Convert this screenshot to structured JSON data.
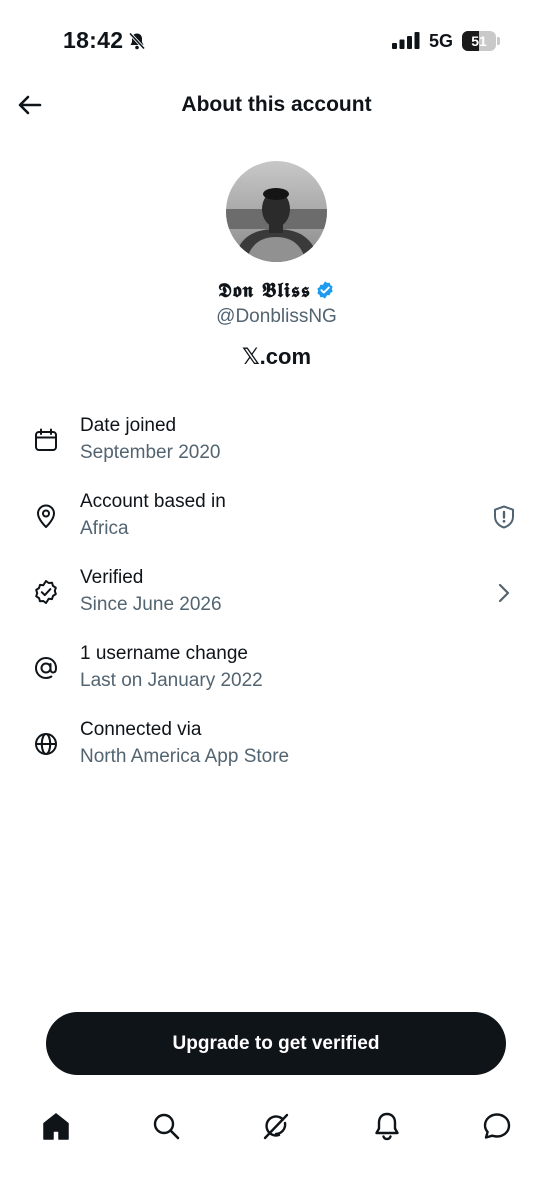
{
  "status_bar": {
    "time": "18:42",
    "network": "5G",
    "battery_level": "51",
    "battery_fraction": 0.51,
    "icons": [
      "bell-slash-icon",
      "signal-bars-icon",
      "battery-icon"
    ]
  },
  "header": {
    "title": "About this account",
    "back_icon": "arrow-left-icon"
  },
  "profile": {
    "display_name": "𝕯𝖔𝖓 𝕭𝖑𝖎𝖘𝖘",
    "handle": "@DonblissNG",
    "site": "𝕏.com",
    "verified": true,
    "badge_color": "#1d9bf0"
  },
  "info_rows": [
    {
      "icon": "calendar-icon",
      "title": "Date joined",
      "subtitle": "September 2020"
    },
    {
      "icon": "location-pin-icon",
      "title": "Account based in",
      "subtitle": "Africa",
      "right_icon": "shield-alert-icon"
    },
    {
      "icon": "verified-seal-icon",
      "title": "Verified",
      "subtitle": "Since June 2026",
      "right_icon": "chevron-right-icon"
    },
    {
      "icon": "at-sign-icon",
      "title": "1 username change",
      "subtitle": "Last on January 2022"
    },
    {
      "icon": "globe-icon",
      "title": "Connected via",
      "subtitle": "North America App Store"
    }
  ],
  "upgrade_button": {
    "label": "Upgrade to get verified"
  },
  "bottom_nav": [
    {
      "icon": "home-icon",
      "active": true
    },
    {
      "icon": "search-icon",
      "active": false
    },
    {
      "icon": "grok-icon",
      "active": false
    },
    {
      "icon": "bell-icon",
      "active": false
    },
    {
      "icon": "message-icon",
      "active": false
    }
  ],
  "colors": {
    "text_primary": "#0f1419",
    "text_secondary": "#536471",
    "accent": "#1d9bf0",
    "button_bg": "#0f1419"
  }
}
